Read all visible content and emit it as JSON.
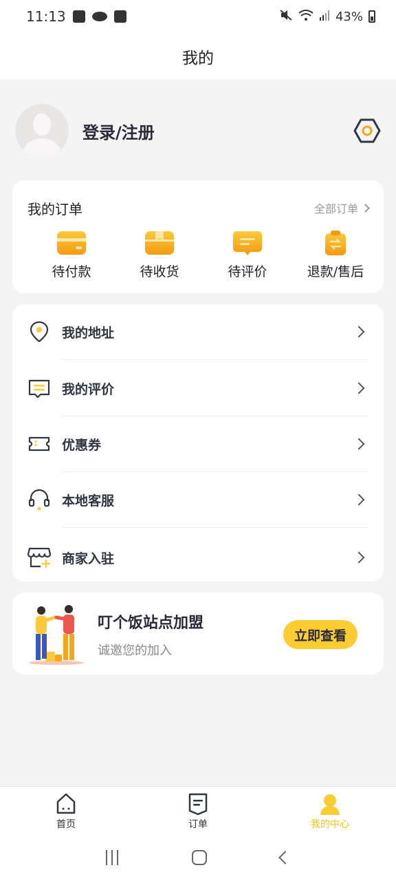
{
  "status_bar": {
    "time": "11:13",
    "battery": "43%"
  },
  "header": {
    "title": "我的"
  },
  "profile": {
    "login_label": "登录/注册"
  },
  "orders": {
    "title": "我的订单",
    "all_label": "全部订单",
    "items": [
      {
        "label": "待付款",
        "icon": "wallet-icon"
      },
      {
        "label": "待收货",
        "icon": "package-icon"
      },
      {
        "label": "待评价",
        "icon": "comment-icon"
      },
      {
        "label": "退款/售后",
        "icon": "refund-icon"
      }
    ]
  },
  "menu": {
    "items": [
      {
        "label": "我的地址",
        "icon": "location-pin-icon"
      },
      {
        "label": "我的评价",
        "icon": "message-icon"
      },
      {
        "label": "优惠券",
        "icon": "coupon-icon"
      },
      {
        "label": "本地客服",
        "icon": "headset-icon"
      },
      {
        "label": "商家入驻",
        "icon": "shop-icon"
      }
    ]
  },
  "promo": {
    "title": "叮个饭站点加盟",
    "subtitle": "诚邀您的加入",
    "button": "立即查看"
  },
  "bottom_nav": {
    "items": [
      {
        "label": "首页",
        "icon": "home-icon"
      },
      {
        "label": "订单",
        "icon": "order-icon"
      },
      {
        "label": "我的中心",
        "icon": "user-icon",
        "active": true
      }
    ]
  },
  "colors": {
    "accent": "#fccd32",
    "active_nav": "#f4c21b",
    "icon_orange": "#f7a61b"
  }
}
